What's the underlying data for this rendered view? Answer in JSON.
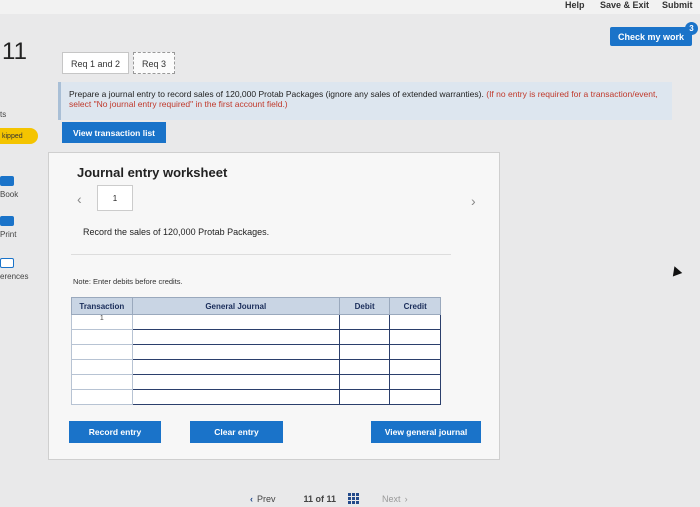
{
  "topbar": {
    "help": "Help",
    "save_exit": "Save & Exit",
    "submit": "Submit"
  },
  "check_button": "Check my work",
  "check_badge": "3",
  "question_number": "11",
  "left_panel": {
    "partial_label": "ts",
    "skipped_label": "kipped",
    "book_label": "Book",
    "print_label": "Print",
    "references_label": "erences"
  },
  "tabs": [
    {
      "label": "Req 1 and 2"
    },
    {
      "label": "Req 3"
    }
  ],
  "instructions": {
    "main": "Prepare a journal entry to record sales of 120,000 Protab Packages (ignore any sales of extended warranties).",
    "red": "(If no entry is required for a transaction/event, select \"No journal entry required\" in the first account field.)"
  },
  "view_transaction_button": "View transaction list",
  "worksheet": {
    "title": "Journal entry worksheet",
    "page": "1",
    "description": "Record the sales of 120,000 Protab Packages.",
    "note": "Note: Enter debits before credits.",
    "columns": [
      "Transaction",
      "General Journal",
      "Debit",
      "Credit"
    ],
    "rows": [
      {
        "transaction": "1"
      },
      {
        "transaction": ""
      },
      {
        "transaction": ""
      },
      {
        "transaction": ""
      },
      {
        "transaction": ""
      },
      {
        "transaction": ""
      }
    ],
    "record_button": "Record entry",
    "clear_button": "Clear entry",
    "view_journal_button": "View general journal"
  },
  "pager": {
    "prev": "Prev",
    "count": "11 of 11",
    "next": "Next"
  },
  "colors": {
    "accent": "#1a73c9",
    "skipped": "#f4c400",
    "instruction_bg": "#dde6ef"
  }
}
